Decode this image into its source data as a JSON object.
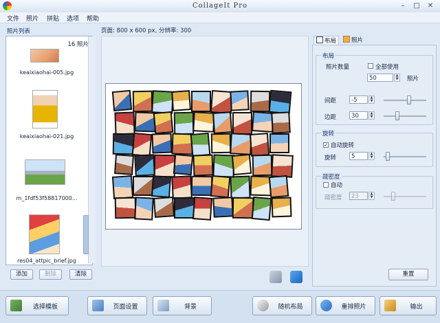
{
  "window": {
    "title": "CollageIt Pro"
  },
  "menu": [
    "文件",
    "照片",
    "拼贴",
    "选项",
    "帮助"
  ],
  "photo_list": {
    "title": "照片列表",
    "count": "16 照片",
    "items": [
      {
        "filename": "keaixiaohai-005.jpg"
      },
      {
        "filename": "keaixiaohai-021.jpg"
      },
      {
        "filename": "m_1fdf53f58817000..."
      },
      {
        "filename": "res04_attpic_brief.jpg"
      }
    ],
    "buttons": {
      "add": "添加",
      "remove": "删除",
      "clear": "清除"
    }
  },
  "canvas": {
    "info": "页面: 800 x 600 px, 分辨率: 300"
  },
  "tabs": {
    "layout": "布局",
    "photo": "照片"
  },
  "layout_group": {
    "legend": "布局",
    "photo_count_label": "照片数量",
    "use_all_label": "全部使用",
    "use_all_checked": false,
    "photo_count": "50",
    "photo_unit": "照片",
    "spacing_label": "间距",
    "spacing": "-5",
    "spacing_slider": 0.6,
    "margin_label": "边距",
    "margin": "30",
    "margin_slider": 0.3
  },
  "rotation_group": {
    "legend": "旋转",
    "auto_rotate_label": "自动旋转",
    "auto_rotate_checked": true,
    "rotation_label": "旋转",
    "rotation": "5",
    "rotation_slider": 0.05
  },
  "density_group": {
    "legend": "疏密度",
    "auto_label": "自动",
    "auto_checked": false,
    "density_label": "疏密度",
    "density": "23",
    "density_slider": 0.2
  },
  "reset_label": "重置",
  "bottom_buttons": {
    "template": "选择模板",
    "page_setup": "页面设置",
    "background": "背景",
    "random_layout": "随机布局",
    "shuffle": "重排照片",
    "export": "输出"
  }
}
